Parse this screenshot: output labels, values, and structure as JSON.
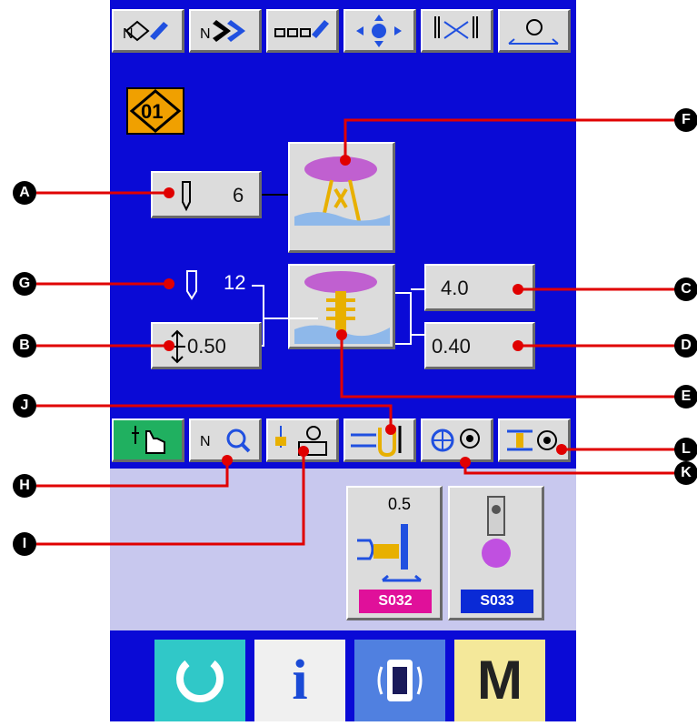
{
  "pattern_no": "01",
  "values": {
    "needle_count": "6",
    "needle_count_ref": "12",
    "thread_height": "0.50",
    "upper_value": "4.0",
    "lower_value": "0.40"
  },
  "programs": [
    {
      "value": "0.5",
      "badge": "S032",
      "badge_color": "#e0109a"
    },
    {
      "value": "",
      "badge": "S033",
      "badge_color": "#0a2ad6"
    }
  ],
  "callouts": [
    "A",
    "B",
    "C",
    "D",
    "E",
    "F",
    "G",
    "H",
    "I",
    "J",
    "K",
    "L"
  ],
  "bottom": {
    "info_label": "i",
    "menu_label": "M"
  },
  "colors": {
    "panel": "#0a0ad6",
    "lower": "#c8c8ee",
    "accent": "#f0a000"
  }
}
